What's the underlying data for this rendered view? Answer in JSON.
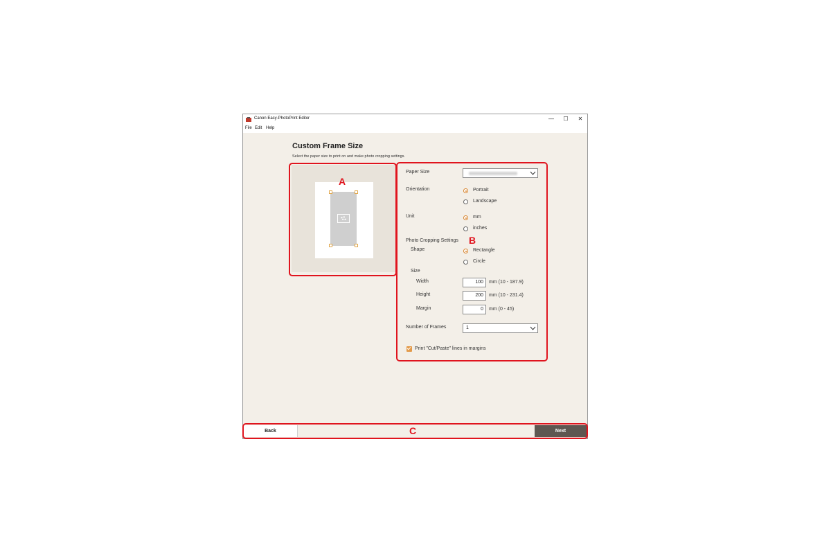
{
  "window": {
    "title": "Canon Easy-PhotoPrint Editor",
    "controls": {
      "minimize": "—",
      "maximize": "☐",
      "close": "✕"
    }
  },
  "menu": [
    "File",
    "Edit",
    "Help"
  ],
  "page": {
    "title": "Custom Frame Size",
    "subtitle": "Select the paper size to print on and make photo cropping settings."
  },
  "settings": {
    "paper_size_label": "Paper Size",
    "orientation_label": "Orientation",
    "orientation_options": [
      "Portrait",
      "Landscape"
    ],
    "orientation_selected": "Portrait",
    "unit_label": "Unit",
    "unit_options": [
      "mm",
      "inches"
    ],
    "unit_selected": "mm",
    "cropping_label": "Photo Cropping Settings",
    "shape_label": "Shape",
    "shape_options": [
      "Rectangle",
      "Circle"
    ],
    "shape_selected": "Rectangle",
    "size_label": "Size",
    "width_label": "Width",
    "width_value": "100",
    "width_range": "mm (10 - 187.9)",
    "height_label": "Height",
    "height_value": "200",
    "height_range": "mm (10 - 231.4)",
    "margin_label": "Margin",
    "margin_value": "0",
    "margin_range": "mm (0 - 45)",
    "frames_label": "Number of Frames",
    "frames_value": "1",
    "cutpaste_label": "Print \"Cut/Paste\" lines in margins",
    "cutpaste_checked": true
  },
  "buttons": {
    "back": "Back",
    "next": "Next"
  },
  "callouts": {
    "a": "A",
    "b": "B",
    "c": "C"
  },
  "colors": {
    "accent": "#d7842d",
    "callout": "#e0141e",
    "next_button": "#5e5751",
    "background": "#f3efe8"
  },
  "icons": [
    "app-icon",
    "minimize-icon",
    "maximize-icon",
    "close-icon",
    "chevron-down-icon",
    "photo-placeholder-icon",
    "checkmark-icon"
  ]
}
